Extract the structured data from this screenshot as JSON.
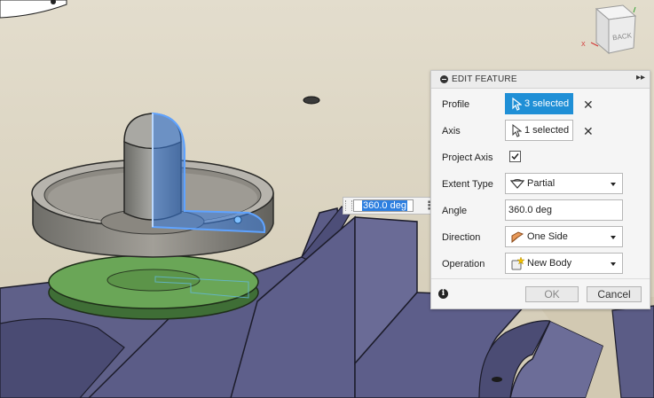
{
  "inline_value": {
    "text": "360.0 deg"
  },
  "viewcube": {
    "face_label": "BACK"
  },
  "dialog": {
    "title": "EDIT FEATURE",
    "profile": {
      "label": "Profile",
      "selection": "3 selected"
    },
    "axis": {
      "label": "Axis",
      "selection": "1 selected"
    },
    "project_axis": {
      "label": "Project Axis",
      "checked": true
    },
    "extent_type": {
      "label": "Extent Type",
      "value": "Partial"
    },
    "angle": {
      "label": "Angle",
      "value": "360.0 deg"
    },
    "direction": {
      "label": "Direction",
      "value": "One Side"
    },
    "operation": {
      "label": "Operation",
      "value": "New Body"
    },
    "ok_label": "OK",
    "cancel_label": "Cancel"
  },
  "colors": {
    "active_selection": "#1f8fd6",
    "sketch_highlight": "#3a7de0",
    "viewport_bg": "#ddd6c4",
    "body_purple": "#5e5f8a",
    "green_body": "#5e9b4e"
  }
}
